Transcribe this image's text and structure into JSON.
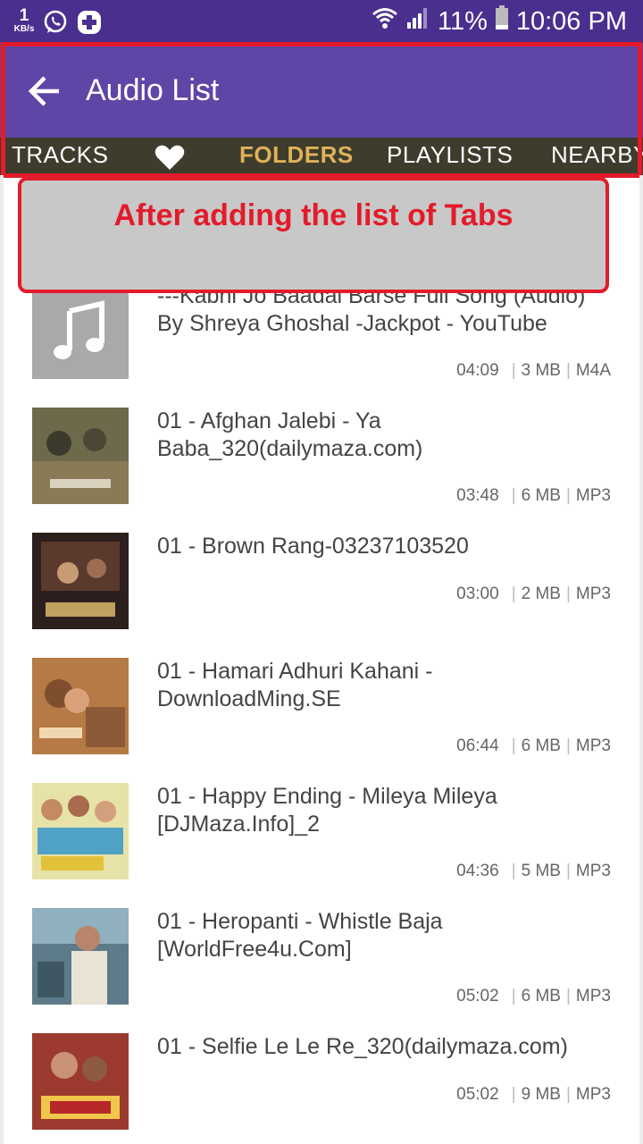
{
  "status_bar": {
    "speed_value": "1",
    "speed_unit": "KB/s",
    "battery": "11%",
    "time": "10:06 PM",
    "icons": [
      "whatsapp-icon",
      "plus-cross-icon",
      "wifi-icon",
      "signal-icon",
      "battery-icon"
    ]
  },
  "toolbar": {
    "title": "Audio List",
    "back_icon": "arrow-left-icon"
  },
  "tabs": [
    {
      "label": "TRACKS",
      "active": false
    },
    {
      "label": "",
      "icon": "heart-icon",
      "active": false
    },
    {
      "label": "FOLDERS",
      "active": true
    },
    {
      "label": "PLAYLISTS",
      "active": false
    },
    {
      "label": "NEARBY",
      "active": false
    }
  ],
  "annotation": {
    "text": "After adding the list of Tabs"
  },
  "tracks": [
    {
      "title": "---Kabhi Jo Baadal Barse Full Song (Audio) By Shreya Ghoshal -Jackpot - YouTube",
      "duration": "04:09",
      "size": "3 MB",
      "format": "M4A",
      "thumb": "music-note-icon"
    },
    {
      "title": "01 - Afghan Jalebi - Ya Baba_320(dailymaza.com)",
      "duration": "03:48",
      "size": "6 MB",
      "format": "MP3",
      "thumb": "album-art"
    },
    {
      "title": "01 - Brown Rang-03237103520",
      "duration": "03:00",
      "size": "2 MB",
      "format": "MP3",
      "thumb": "album-art"
    },
    {
      "title": "01 - Hamari Adhuri Kahani - DownloadMing.SE",
      "duration": "06:44",
      "size": "6 MB",
      "format": "MP3",
      "thumb": "album-art"
    },
    {
      "title": "01 - Happy Ending - Mileya Mileya [DJMaza.Info]_2",
      "duration": "04:36",
      "size": "5 MB",
      "format": "MP3",
      "thumb": "album-art"
    },
    {
      "title": "01 - Heropanti - Whistle Baja [WorldFree4u.Com]",
      "duration": "05:02",
      "size": "6 MB",
      "format": "MP3",
      "thumb": "album-art"
    },
    {
      "title": "01 - Selfie Le Le Re_320(dailymaza.com)",
      "duration": "05:02",
      "size": "9 MB",
      "format": "MP3",
      "thumb": "album-art"
    }
  ],
  "colors": {
    "status_bar": "#4a2f8f",
    "toolbar": "#5f45a5",
    "tab_bar": "#3e3c2c",
    "active_tab": "#e0b25a",
    "annotation_red": "#e31b2a"
  }
}
